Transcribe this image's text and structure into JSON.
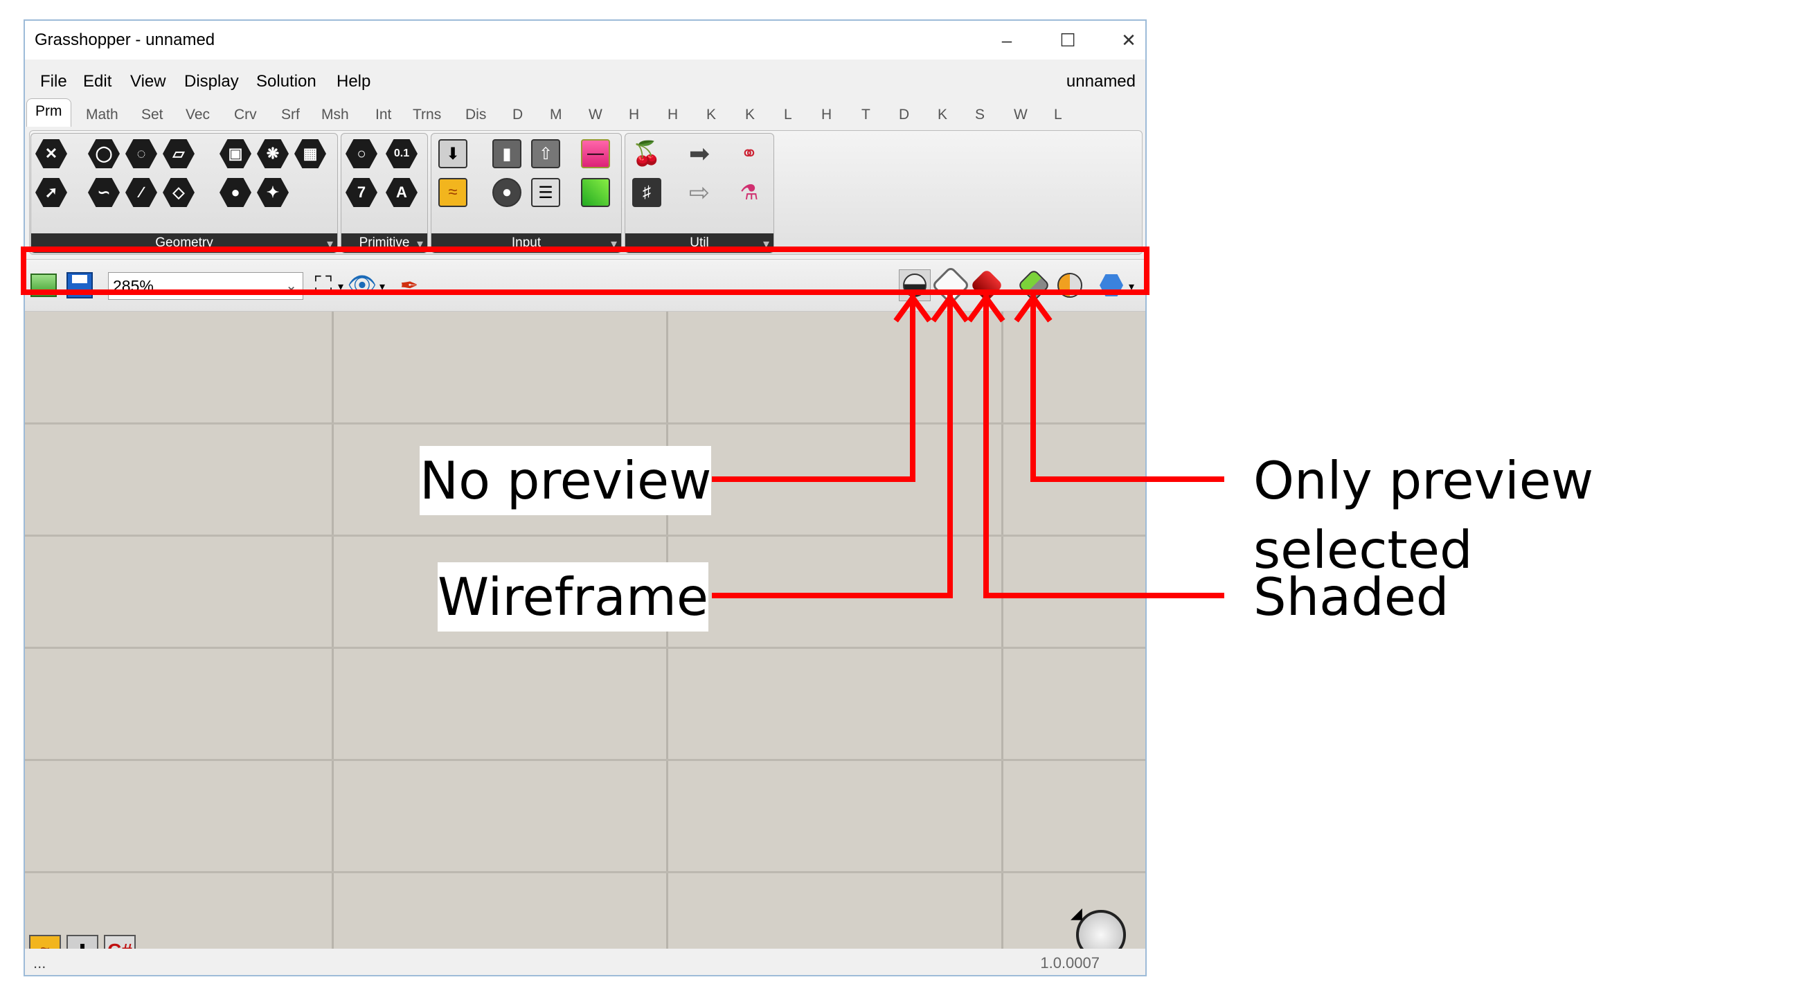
{
  "window": {
    "title": "Grasshopper - unnamed",
    "document_name": "unnamed",
    "minimize_icon": "minimize-icon",
    "maximize_icon": "maximize-icon",
    "close_icon": "close-icon"
  },
  "menu": [
    "File",
    "Edit",
    "View",
    "Display",
    "Solution",
    "Help"
  ],
  "tabs": [
    "Prm",
    "Math",
    "Set",
    "Vec",
    "Crv",
    "Srf",
    "Msh",
    "Int",
    "Trns",
    "Dis",
    "D",
    "M",
    "W",
    "H",
    "H",
    "K",
    "K",
    "L",
    "H",
    "T",
    "D",
    "K",
    "S",
    "W",
    "L"
  ],
  "active_tab": "Prm",
  "ribbon": {
    "panels": [
      {
        "label": "Geometry"
      },
      {
        "label": "Primitive"
      },
      {
        "label": "Input"
      },
      {
        "label": "Util"
      }
    ],
    "primitive_glyphs": [
      "7",
      "A",
      "0.1"
    ]
  },
  "toolbar": {
    "zoom": "285%",
    "left_icons": [
      "open-file-icon",
      "save-file-icon",
      "zoom-extents-icon",
      "preview-eye-icon",
      "sketch-pen-icon"
    ],
    "right_icons": [
      "no-preview-icon",
      "wireframe-preview-icon",
      "shaded-preview-icon",
      "only-preview-selected-icon",
      "document-preview-settings-icon",
      "preview-mesh-quality-icon"
    ]
  },
  "canvas": {
    "bottom_widgets": [
      "panel-widget-icon",
      "data-input-widget-icon",
      "csharp-widget-icon"
    ],
    "bottom_csharp_text": "C#",
    "navigation_icon": "canvas-compass-icon"
  },
  "status": {
    "left": "...",
    "version": "1.0.0007"
  },
  "annotations": {
    "no_preview": "No preview",
    "wireframe": "Wireframe",
    "only_preview_selected": "Only preview selected",
    "shaded": "Shaded"
  },
  "colors": {
    "highlight": "#ff0000",
    "canvas": "#d4d0c8",
    "window_border": "#9dbbd8"
  }
}
